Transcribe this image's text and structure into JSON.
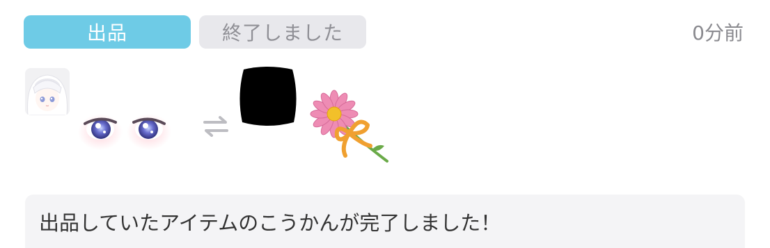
{
  "notification": {
    "listing_tag": "出品",
    "status_tag": "終了しました",
    "timestamp": "0分前",
    "message": "出品していたアイテムのこうかんが完了しました！"
  },
  "colors": {
    "listing_tag_bg": "#6ecbe6",
    "status_tag_bg": "#e8e8ec",
    "message_bg": "#f4f4f6"
  },
  "icons": {
    "avatar": "avatar-thumbnail",
    "offered_item": "anime-eyes-item-icon",
    "swap": "exchange-arrows-icon",
    "received_item_owner": "redacted-black-mark",
    "received_item": "flower-with-ribbon-item-icon"
  }
}
